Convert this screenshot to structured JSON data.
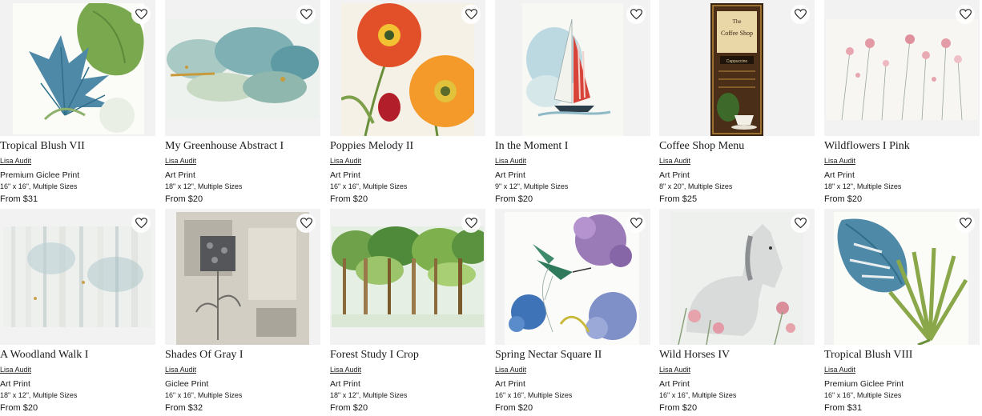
{
  "products": [
    {
      "title": "Tropical Blush VII",
      "artist": "Lisa Audit",
      "type": "Premium Giclee Print",
      "size": "16\" x 16\", Multiple Sizes",
      "price": "From $31"
    },
    {
      "title": "My Greenhouse Abstract I",
      "artist": "Lisa Audit",
      "type": "Art Print",
      "size": "18\" x 12\", Multiple Sizes",
      "price": "From $20"
    },
    {
      "title": "Poppies Melody II",
      "artist": "Lisa Audit",
      "type": "Art Print",
      "size": "16\" x 16\", Multiple Sizes",
      "price": "From $20"
    },
    {
      "title": "In the Moment I",
      "artist": "Lisa Audit",
      "type": "Art Print",
      "size": "9\" x 12\", Multiple Sizes",
      "price": "From $20"
    },
    {
      "title": "Coffee Shop Menu",
      "artist": "Lisa Audit",
      "type": "Art Print",
      "size": "8\" x 20\", Multiple Sizes",
      "price": "From $25"
    },
    {
      "title": "Wildflowers I Pink",
      "artist": "Lisa Audit",
      "type": "Art Print",
      "size": "18\" x 12\", Multiple Sizes",
      "price": "From $20"
    },
    {
      "title": "A Woodland Walk I",
      "artist": "Lisa Audit",
      "type": "Art Print",
      "size": "18\" x 12\", Multiple Sizes",
      "price": "From $20"
    },
    {
      "title": "Shades Of Gray I",
      "artist": "Lisa Audit",
      "type": "Giclee Print",
      "size": "16\" x 16\", Multiple Sizes",
      "price": "From $32"
    },
    {
      "title": "Forest Study I Crop",
      "artist": "Lisa Audit",
      "type": "Art Print",
      "size": "18\" x 12\", Multiple Sizes",
      "price": "From $20"
    },
    {
      "title": "Spring Nectar Square II",
      "artist": "Lisa Audit",
      "type": "Art Print",
      "size": "16\" x 16\", Multiple Sizes",
      "price": "From $20"
    },
    {
      "title": "Wild Horses IV",
      "artist": "Lisa Audit",
      "type": "Art Print",
      "size": "16\" x 16\", Multiple Sizes",
      "price": "From $20"
    },
    {
      "title": "Tropical Blush VIII",
      "artist": "Lisa Audit",
      "type": "Premium Giclee Print",
      "size": "16\" x 16\", Multiple Sizes",
      "price": "From $31"
    }
  ],
  "coffee_shop_art": {
    "line1": "The",
    "line2": "Coffee Shop",
    "line3": "Cappuccino"
  },
  "icons": {
    "favorite": "heart-outline-icon"
  }
}
